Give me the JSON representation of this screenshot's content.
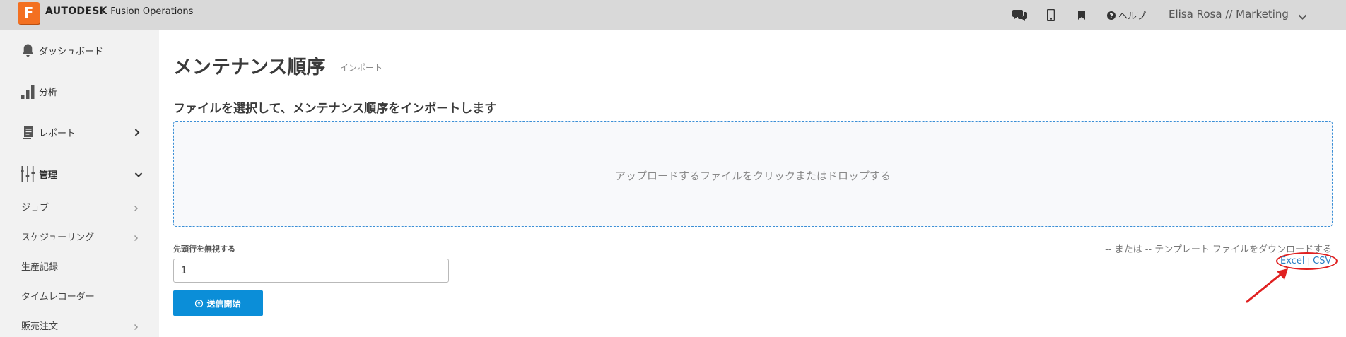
{
  "topbar": {
    "logo_letter": "F",
    "brand_strong": "AUTODESK",
    "brand_product": "Fusion Operations",
    "icons": [
      "chat-icon",
      "mobile-icon",
      "bookmark-icon"
    ],
    "help_label": "ヘルプ",
    "user_label": "Elisa Rosa // Marketing"
  },
  "sidebar": {
    "items": [
      {
        "label": "ダッシュボード",
        "icon": "bell-icon"
      },
      {
        "label": "分析",
        "icon": "bar-chart-icon"
      },
      {
        "label": "レポート",
        "icon": "report-icon"
      },
      {
        "label": "管理",
        "icon": "sliders-icon"
      }
    ],
    "sub_items": [
      {
        "label": "ジョブ",
        "has_chevron": true
      },
      {
        "label": "スケジューリング",
        "has_chevron": true
      },
      {
        "label": "生産記録",
        "has_chevron": false
      },
      {
        "label": "タイムレコーダー",
        "has_chevron": false
      },
      {
        "label": "販売注文",
        "has_chevron": true
      }
    ]
  },
  "main": {
    "title": "メンテナンス順序",
    "subtitle": "インポート",
    "section_title": "ファイルを選択して、メンテナンス順序をインポートします",
    "dropzone_text": "アップロードするファイルをクリックまたはドロップする",
    "skip_label": "先頭行を無視する",
    "skip_value": "1",
    "submit_label": "送信開始",
    "template_text": "-- または -- テンプレート ファイルをダウンロードする",
    "template_links": {
      "excel": "Excel",
      "separator": "|",
      "csv": "CSV"
    }
  },
  "colors": {
    "accent": "#0b8ed8",
    "brand": "#f37021",
    "highlight": "#e02020"
  }
}
